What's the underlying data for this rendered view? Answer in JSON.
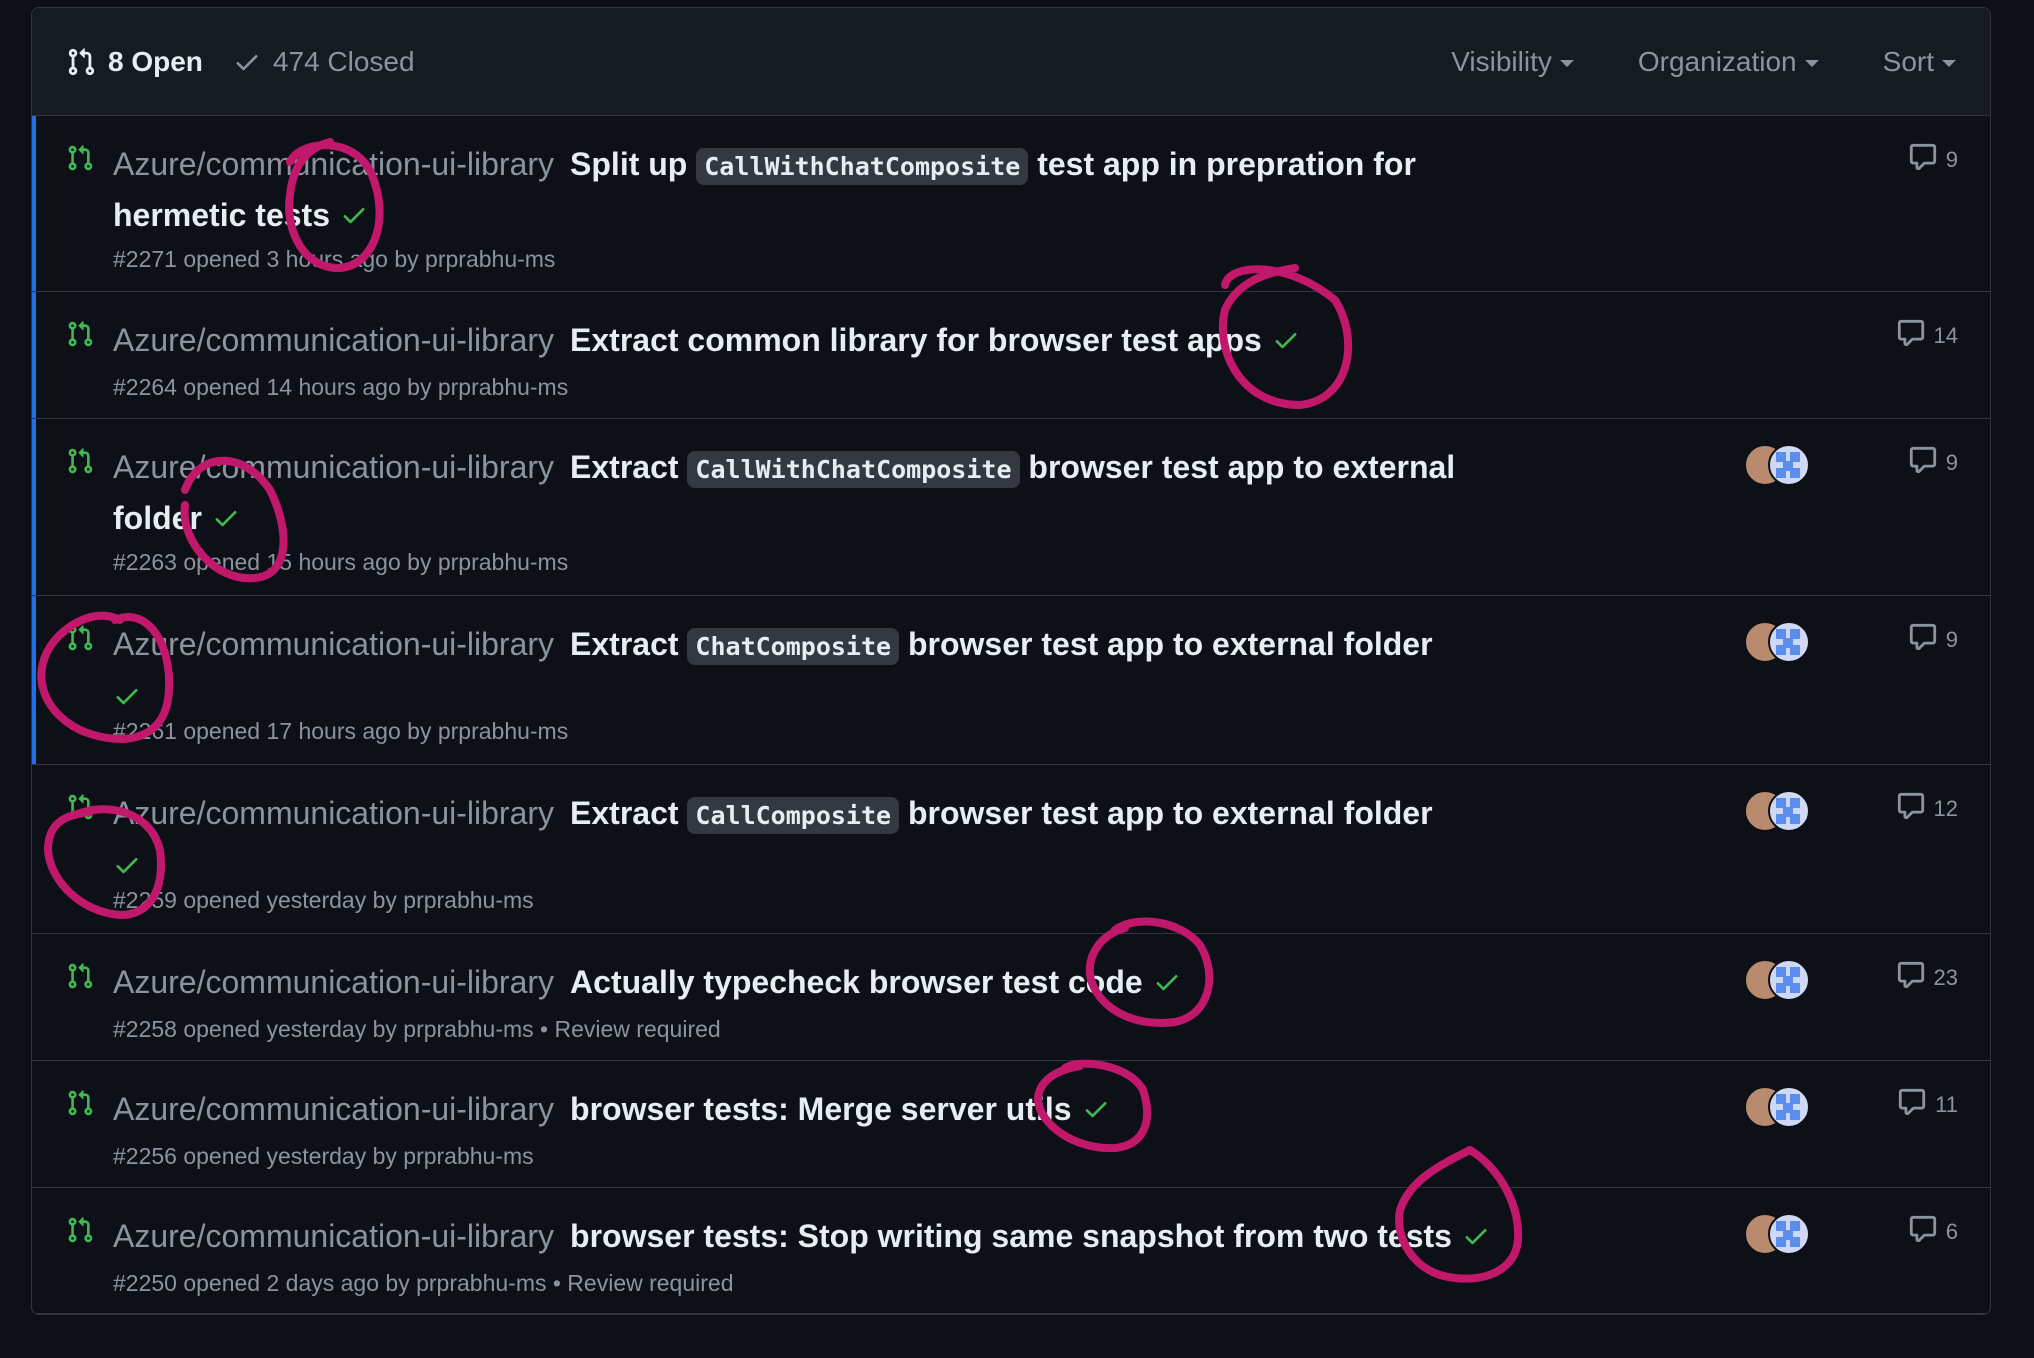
{
  "header": {
    "open_label": "8 Open",
    "closed_label": "474 Closed",
    "filters": [
      "Visibility",
      "Organization",
      "Sort"
    ]
  },
  "prs": [
    {
      "repo": "Azure/communication-ui-library",
      "title_before": "Split up ",
      "code": "CallWithChatComposite",
      "title_after": " test app in prepration for hermetic tests",
      "meta": "#2271 opened 3 hours ago by prprabhu-ms",
      "comments": "9",
      "avatars": false
    },
    {
      "repo": "Azure/communication-ui-library",
      "title_before": "Extract common library for browser test apps",
      "code": "",
      "title_after": "",
      "meta": "#2264 opened 14 hours ago by prprabhu-ms",
      "comments": "14",
      "avatars": false
    },
    {
      "repo": "Azure/communication-ui-library",
      "title_before": "Extract ",
      "code": "CallWithChatComposite",
      "title_after": " browser test app to external folder",
      "meta": "#2263 opened 15 hours ago by prprabhu-ms",
      "comments": "9",
      "avatars": true
    },
    {
      "repo": "Azure/communication-ui-library",
      "title_before": "Extract ",
      "code": "ChatComposite",
      "title_after": " browser test app to external folder",
      "meta": "#2261 opened 17 hours ago by prprabhu-ms",
      "comments": "9",
      "avatars": true
    },
    {
      "repo": "Azure/communication-ui-library",
      "title_before": "Extract ",
      "code": "CallComposite",
      "title_after": " browser test app to external folder",
      "meta": "#2259 opened yesterday by prprabhu-ms",
      "comments": "12",
      "avatars": true
    },
    {
      "repo": "Azure/communication-ui-library",
      "title_before": "Actually typecheck browser test code",
      "code": "",
      "title_after": "",
      "meta": "#2258 opened yesterday by prprabhu-ms • Review required",
      "comments": "23",
      "avatars": true
    },
    {
      "repo": "Azure/communication-ui-library",
      "title_before": "browser tests: Merge server utils",
      "code": "",
      "title_after": "",
      "meta": "#2256 opened yesterday by prprabhu-ms",
      "comments": "11",
      "avatars": true
    },
    {
      "repo": "Azure/communication-ui-library",
      "title_before": "browser tests: Stop writing same snapshot from two tests",
      "code": "",
      "title_after": "",
      "meta": "#2250 opened 2 days ago by prprabhu-ms • Review required",
      "comments": "6",
      "avatars": true
    }
  ],
  "colors": {
    "accent_blue": "#1f6feb",
    "success_green": "#3fb950",
    "annotation": "#c2186b"
  }
}
